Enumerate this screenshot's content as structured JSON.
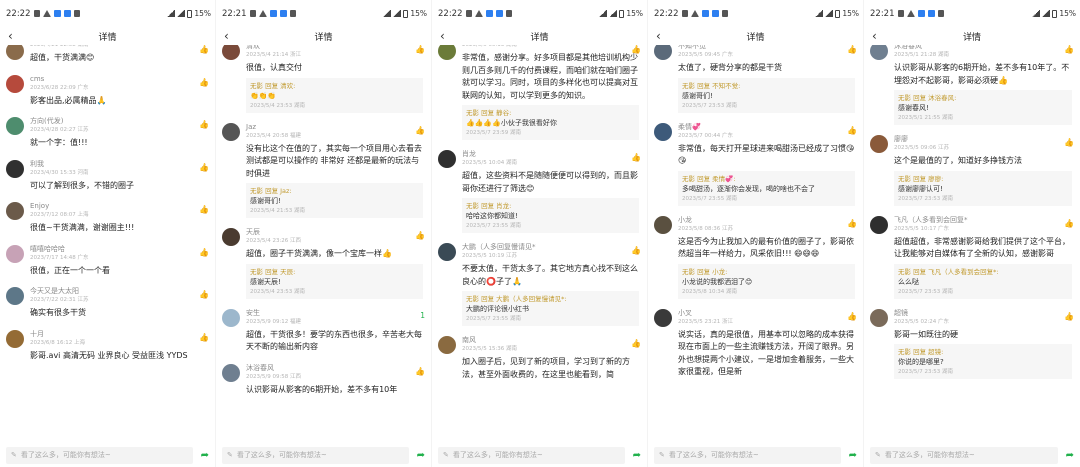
{
  "screens": [
    {
      "time": "22:22",
      "battery": "15%",
      "title": "详情",
      "comments": [
        {
          "name": "",
          "meta": "2023/4/21 22:58 湖南",
          "text": "超值，干货满满😊",
          "avatar": "#8a6b4b"
        },
        {
          "name": "cms",
          "meta": "2023/6/28 22:09 广东",
          "text": "影客出品,必属精品🙏",
          "avatar": "#b64a3c"
        },
        {
          "name": "方向(代发)",
          "meta": "2023/4/28 02:27 江苏",
          "text": "就一个字：值!!!",
          "avatar": "#4e8d6e"
        },
        {
          "name": "利我",
          "meta": "2023/4/30 15:33 河南",
          "text": "可以了解到很多，不错的圈子",
          "avatar": "#303030"
        },
        {
          "name": "Enjoy",
          "meta": "2023/7/12 08:07 上海",
          "text": "很值~干货满满，谢谢圈主!!!",
          "avatar": "#6b5a4a"
        },
        {
          "name": "嘻嘻哈哈哈",
          "meta": "2023/7/17 14:48 广东",
          "text": "很值，正在一个一个看",
          "avatar": "#c7a2b6"
        },
        {
          "name": "今天又是大太阳",
          "meta": "2023/7/22 02:31 江苏",
          "text": "确实有很多干货",
          "avatar": "#5d7788"
        },
        {
          "name": "十月",
          "meta": "2023/6/8 16:12 上海",
          "text": "影哥.avi 高清无码 业界良心 受益匪浅 YYDS",
          "avatar": "#946b35"
        }
      ],
      "input_placeholder": "看了这么多，可能你有想法~"
    },
    {
      "time": "22:21",
      "battery": "15%",
      "title": "详情",
      "comments": [
        {
          "name": "清欢",
          "meta": "2023/5/4 21:14 浙江",
          "text": "很值，认真交付",
          "avatar": "#7a4a3a",
          "reply": {
            "head": "无影 回复 清欢:",
            "text": "👏👏👏",
            "meta": "2023/5/4 23:53 湖南"
          }
        },
        {
          "name": "Jaz",
          "meta": "2023/5/4 20:58 福建",
          "text": "没有比这个在值的了，其实每一个项目用心去看去测试都是可以操作的 非常好 还都是最新的玩法与时俱进",
          "avatar": "#555555",
          "reply": {
            "head": "无影 回复 Jaz:",
            "text": "感谢哥们!",
            "meta": "2023/5/4 21:53 湖南"
          }
        },
        {
          "name": "天辰",
          "meta": "2023/5/4 23:26 江西",
          "text": "超值，圈子干货满满，像一个宝库一样👍",
          "avatar": "#4a3b30",
          "reply": {
            "head": "无影 回复 天辰:",
            "text": "感谢天辰!",
            "meta": "2023/5/4 23:53 湖南"
          }
        },
        {
          "name": "安生",
          "meta": "2023/5/9 09:12 福建",
          "text": "超值，干货很多！要学的东西也很多，辛苦老大每天不断的输出新内容",
          "avatar": "#9cb7cc",
          "likes": "1"
        },
        {
          "name": "沐浴春风",
          "meta": "2023/5/9 09:58 江西",
          "text": "认识影哥从影客的6期开始，差不多有10年",
          "avatar": "#6f7f90"
        }
      ],
      "input_placeholder": "看了这么多，可能你有想法~"
    },
    {
      "time": "22:22",
      "battery": "15%",
      "title": "详情",
      "comments": [
        {
          "name": "",
          "meta": "2023/5/5 05:13 湖南",
          "text": "非常值，感谢分享。好多项目都是其他培训机构少则几百多则几千的付费课程，而咱们就在咱们圈子就可以学习。同时，项目的多样化也可以提高对互联网的认知，可以学到更多的知识。",
          "avatar": "#6b7b39",
          "reply": {
            "head": "无影 回复 静谷:",
            "text": "👍👍👍👍小伙子我很看好你",
            "meta": "2023/5/7 23:59 湖南"
          }
        },
        {
          "name": "肖龙",
          "meta": "2023/5/5 10:04 湖南",
          "text": "超值，这些资料不是随随便便可以得到的，而且影哥你还进行了筛选😊",
          "avatar": "#2f2f2f",
          "reply": {
            "head": "无影 回复 肖龙:",
            "text": "哈哈这你都知道!",
            "meta": "2023/5/7 23:55 湖南"
          }
        },
        {
          "name": "大鹏（人多回复慢请见*",
          "meta": "2023/5/5 10:19 江苏",
          "text": "不要太值，干货太多了。其它地方真心找不到这么良心的⭕子了🙏",
          "avatar": "#3a4a55",
          "reply": {
            "head": "无影 回复 大鹏（人多回复慢请见*:",
            "text": "大鹏的评论很小红书",
            "meta": "2023/5/7 23:55 湖南"
          }
        },
        {
          "name": "南风",
          "meta": "2023/5/5 15:36 湖南",
          "text": "加入圈子后，见到了新的项目，学习到了新的方法，甚至外面收费的，在这里也能看到，简",
          "avatar": "#8a6a40"
        }
      ],
      "input_placeholder": "看了这么多，可能你有想法~"
    },
    {
      "time": "22:22",
      "battery": "15%",
      "title": "详情",
      "comments": [
        {
          "name": "不知不觉",
          "meta": "2023/5/5 09:45 广东",
          "text": "太值了，硬背分享的都是干货",
          "avatar": "#5b6a7a",
          "reply": {
            "head": "无影 回复 不知不觉:",
            "text": "感谢哥们!",
            "meta": "2023/5/7 23:53 湖南"
          }
        },
        {
          "name": "柔情💞",
          "meta": "2023/5/7 00:44 广东",
          "text": "非常值，每天打开星球进来喝甜汤已经成了习惯😘😘",
          "avatar": "#3d5a7a",
          "reply": {
            "head": "无影 回复 柔情💞:",
            "text": "多喝甜汤，逐渐你会发现，喝的啥也不会了",
            "meta": "2023/5/7 23:55 湖南"
          }
        },
        {
          "name": "小龙",
          "meta": "2023/5/8 08:36 江苏",
          "text": "这是否今为止我加入的最有价值的圈子了，影哥依然超当年一样给力，风采依旧!!! 😄😄😄",
          "avatar": "#5a5040",
          "reply": {
            "head": "无影 回复 小龙:",
            "text": "小龙说的我都洒泪了😊",
            "meta": "2023/5/8 10:34 湖南"
          }
        },
        {
          "name": "小叉",
          "meta": "2023/5/5 23:21 浙江",
          "text": "说实话，真的是很值，用基本可以忽略的成本获得现在市面上的一些主流赚钱方法，开阔了眼界。另外也想提两个小建议，一是增加金着服务，一些大家很重视，但是新",
          "avatar": "#3a3a3a"
        }
      ],
      "input_placeholder": "看了这么多，可能你有想法~"
    },
    {
      "time": "22:21",
      "battery": "15%",
      "title": "详情",
      "comments": [
        {
          "name": "沐浴春风",
          "meta": "2023/5/1 21:28 湖南",
          "text": "认识影哥从影客的6期开始，差不多有10年了。不埋怨对不起影哥，影哥必须硬👍",
          "avatar": "#6f7f90",
          "reply": {
            "head": "无影 回复 沐浴春风:",
            "text": "感谢春风!",
            "meta": "2023/5/1 21:55 湖南"
          }
        },
        {
          "name": "廖廖",
          "meta": "2023/5/5 09:06 江苏",
          "text": "这个是最值的了，知道好多挣钱方法",
          "avatar": "#8a5a3a",
          "reply": {
            "head": "无影 回复 廖廖:",
            "text": "感谢廖廖认可!",
            "meta": "2023/5/7 23:53 湖南"
          }
        },
        {
          "name": "飞凡（人多看到会回复*",
          "meta": "2023/5/5 10:17 广东",
          "text": "超值超值，非常感谢影哥给我们提供了这个平台，让我能够对自媒体有了全新的认知，感谢影哥",
          "avatar": "#2f2f2f",
          "reply": {
            "head": "无影 回复 飞凡（人多看到会回复*:",
            "text": "么么哒",
            "meta": "2023/5/7 23:53 湖南"
          }
        },
        {
          "name": "超镜",
          "meta": "2023/5/5 02:24 广东",
          "text": "影哥一如既往的硬",
          "avatar": "#7a6a5a",
          "reply": {
            "head": "无影 回复 超镜:",
            "text": "你说的是哪里?",
            "meta": "2023/5/7 23:53 湖南"
          }
        }
      ],
      "input_placeholder": "看了这么多，可能你有想法~"
    }
  ]
}
